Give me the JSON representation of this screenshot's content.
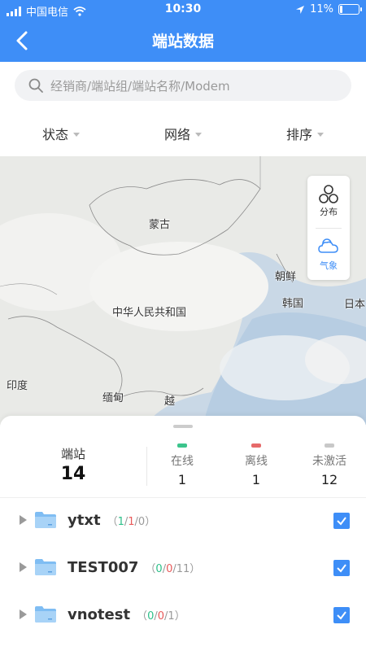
{
  "status_bar": {
    "carrier": "中国电信",
    "time": "10:30",
    "battery": "11%"
  },
  "header": {
    "title": "端站数据"
  },
  "search": {
    "placeholder": "经销商/端站组/端站名称/Modem"
  },
  "filters": [
    {
      "label": "状态"
    },
    {
      "label": "网络"
    },
    {
      "label": "排序"
    }
  ],
  "map": {
    "labels": {
      "mongolia": "蒙古",
      "china": "中华人民共和国",
      "north_korea": "朝鲜",
      "south_korea": "韩国",
      "japan": "日本",
      "india": "印度",
      "myanmar": "缅甸",
      "vietnam": "越"
    },
    "controls": {
      "distribution": "分布",
      "weather": "气象"
    }
  },
  "summary": {
    "total_label": "端站",
    "total_value": "14",
    "online_label": "在线",
    "online_value": "1",
    "offline_label": "离线",
    "offline_value": "1",
    "inactive_label": "未激活",
    "inactive_value": "12",
    "colors": {
      "online": "#3cc48c",
      "offline": "#e66a6a",
      "inactive": "#c8c8c8"
    }
  },
  "groups": [
    {
      "name": "ytxt",
      "open": "（",
      "online": "1",
      "s1": "/",
      "offline": "1",
      "s2": "/",
      "inactive": "0",
      "close": "）"
    },
    {
      "name": "TEST007",
      "open": "（",
      "online": "0",
      "s1": "/",
      "offline": "0",
      "s2": "/",
      "inactive": "11",
      "close": "）"
    },
    {
      "name": "vnotest",
      "open": "（",
      "online": "0",
      "s1": "/",
      "offline": "0",
      "s2": "/",
      "inactive": "1",
      "close": "）"
    }
  ],
  "accent": "#3e8ef7"
}
